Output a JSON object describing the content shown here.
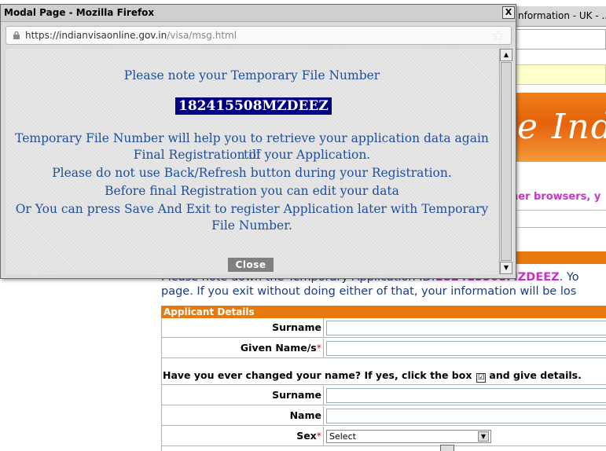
{
  "background": {
    "window_title": "nformation - UK - ...",
    "banner_text": "e Ind",
    "browsers_text": "her browsers, y",
    "note_line1_prefix": "Please note down the Temporary Application ID:",
    "note_line1_id": "182415508MZDEEZ",
    "note_line1_suffix": ". Yo",
    "note_line2": "page. If you exit without doing either of that, your information will be los",
    "section_title": "Applicant Details",
    "labels": {
      "surname": "Surname",
      "given_names": "Given Name/s",
      "surname2": "Surname",
      "name": "Name",
      "sex": "Sex",
      "required_star": "*"
    },
    "changed_name_question_prefix": "Have you ever changed your name? If yes, click the box",
    "changed_name_question_suffix": "and give details.",
    "checkbox_mark": "☑",
    "sex_select_value": "Select"
  },
  "modal": {
    "title": "Modal Page - Mozilla Firefox",
    "close_x": "X",
    "url_host": "https://indianvisaonline.gov.in",
    "url_path": "/visa/msg.html",
    "heading": "Please note your Temporary File Number",
    "file_number": "182415508MZDEEZ",
    "lines": [
      "Temporary File Number will help you to retrieve your application data again till",
      "Final Registration of your Application.",
      "Please do not use Back/Refresh button during your Registration.",
      "Before final Registration you can edit your data",
      "Or You can press Save And Exit to register Application later with Temporary",
      "File Number."
    ],
    "close_button": "Close",
    "icons": {
      "lock": "lock-icon",
      "bookmark": "star-icon"
    }
  }
}
